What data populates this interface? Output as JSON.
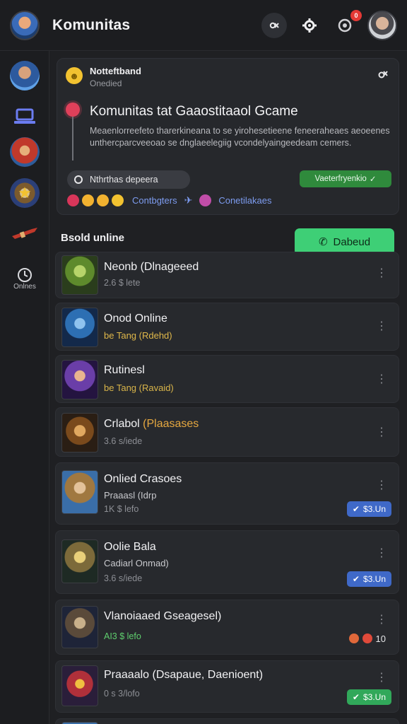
{
  "header": {
    "title": "Komunitas",
    "notification_count": "0"
  },
  "sidebar": {
    "items": [
      {
        "icon": "user-avatar-icon"
      },
      {
        "icon": "laptop-icon"
      },
      {
        "icon": "game-avatar-icon"
      },
      {
        "icon": "star-character-icon"
      },
      {
        "icon": "weapon-icon"
      },
      {
        "icon": "clock-icon",
        "label": "Onlnes"
      }
    ]
  },
  "notification": {
    "label": "Notteftband",
    "sublabel": "Onedied",
    "title": "Komunitas tat Gaaostitaaol Gcame",
    "description": "Meaenlorreefeto tharerkineana to se yirohesetieene feneeraheaes aeoeenes unthercparcveeoao se dnglaeelegiig vcondelyaingeedeam cemers.",
    "status_pill": "Nthrthas depeera",
    "verify_pill": "Vaeterfryenkio",
    "link_1": "Contbgters",
    "link_2": "Conetilakaes"
  },
  "list": {
    "header": "Bsold unline",
    "download_label": "Dabeud",
    "items": [
      {
        "title": "Neonb (Dlnageeed",
        "subtitle": "",
        "meta": "2.6 $ lete",
        "price": ""
      },
      {
        "title": "Onod Online",
        "subtitle": "be Tang (Rdehd)",
        "subtitle_color": "#e0b84a",
        "meta": "",
        "price": ""
      },
      {
        "title": "Rutinesl",
        "subtitle": "be Tang (Ravaid)",
        "subtitle_color": "#d9b54a",
        "meta": "",
        "price": ""
      },
      {
        "title": "Crlabol",
        "title_accent": "(Plaasases",
        "subtitle": "",
        "meta": "3.6 s/iede",
        "price": ""
      },
      {
        "title": "Onlied Crasoes",
        "subtitle": "Praaasl (Idrp",
        "subtitle_color": "#c9cace",
        "meta": "1K $ lefo",
        "price": "$3.Un"
      },
      {
        "title": "Oolie Bala",
        "subtitle": "Cadiarl Onmad)",
        "subtitle_color": "#c9cace",
        "meta": "3.6 s/iede",
        "price": "$3.Un"
      },
      {
        "title": "Vlanoiaaed Gseagesel)",
        "subtitle": "",
        "meta": "AI3 $ lefo",
        "meta_color": "#5fcf6e",
        "price": "10"
      },
      {
        "title": "Praaaalo (Dsapaue, Daenioent)",
        "subtitle": "",
        "meta": "0 s 3/lofo",
        "price": "$3.Un"
      }
    ]
  },
  "colors": {
    "background": "#1f2023",
    "card": "#27292d",
    "accent_green": "#3ecf76",
    "accent_blue": "#3f69c8",
    "link": "#7d9cf0"
  }
}
